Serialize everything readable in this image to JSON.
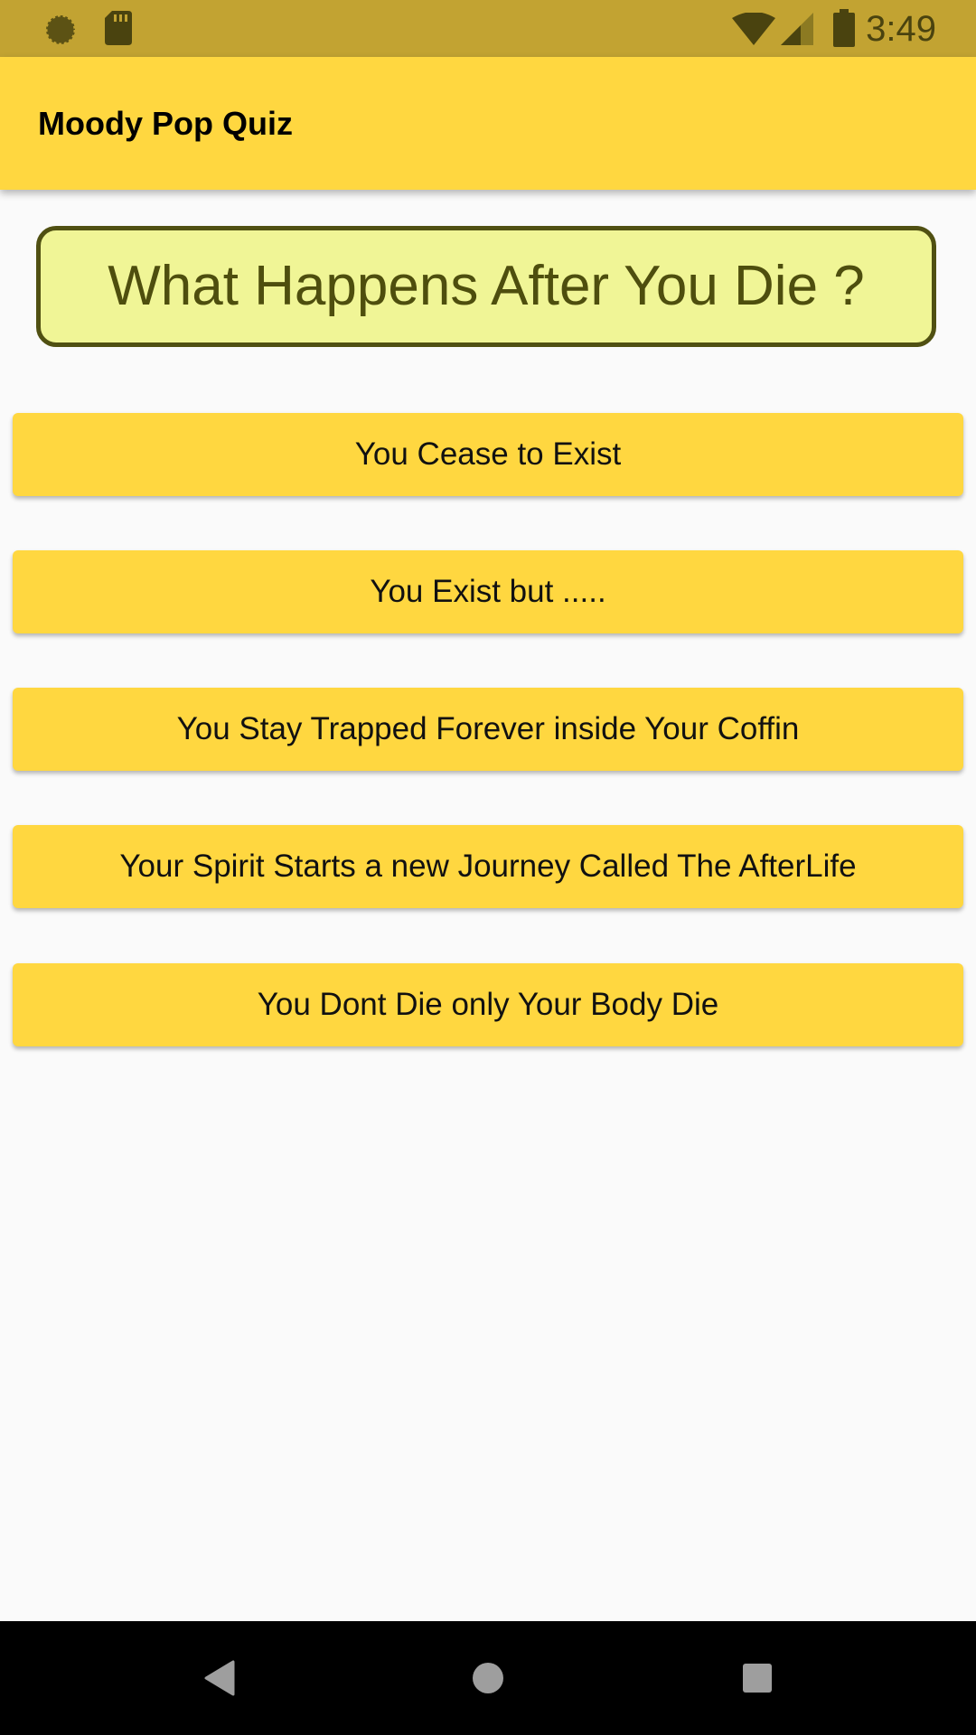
{
  "status_bar": {
    "time": "3:49",
    "icons": [
      "sync-indicator-icon",
      "sd-card-icon",
      "wifi-icon",
      "cell-signal-icon",
      "battery-icon"
    ]
  },
  "app_bar": {
    "title": "Moody Pop Quiz"
  },
  "quiz": {
    "question": "What Happens After You Die ?",
    "answers": [
      {
        "label": "You Cease to Exist"
      },
      {
        "label": "You Exist but ....."
      },
      {
        "label": "You Stay Trapped Forever inside Your Coffin"
      },
      {
        "label": "Your Spirit Starts a new Journey Called The AfterLife"
      },
      {
        "label": "You Dont Die only Your Body Die"
      }
    ]
  },
  "nav_bar": {
    "buttons": [
      "back-icon",
      "home-icon",
      "recents-icon"
    ]
  },
  "colors": {
    "status_bar": "#C2A332",
    "app_bar": "#FFD740",
    "question_background": "#F0F596",
    "question_border": "#505012",
    "button": "#FFD740",
    "background": "#FAFAFA"
  }
}
